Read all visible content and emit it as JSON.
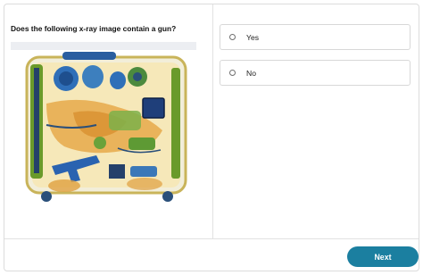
{
  "question": {
    "text": "Does the following x-ray image contain a gun?"
  },
  "image": {
    "alt": "x-ray scan of luggage"
  },
  "options": [
    {
      "label": "Yes"
    },
    {
      "label": "No"
    }
  ],
  "footer": {
    "next_label": "Next"
  },
  "colors": {
    "accent": "#1b7fa0",
    "border": "#d8d8d8"
  }
}
